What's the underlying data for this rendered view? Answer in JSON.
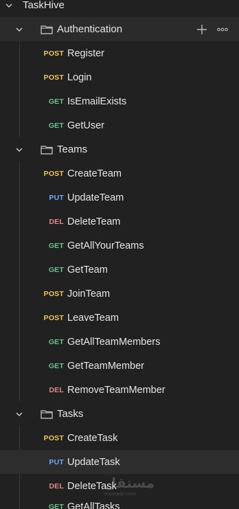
{
  "tree": {
    "root_label": "TaskHive",
    "folders": [
      {
        "label": "Authentication",
        "requests": [
          {
            "method": "POST",
            "name": "Register"
          },
          {
            "method": "POST",
            "name": "Login"
          },
          {
            "method": "GET",
            "name": "IsEmailExists"
          },
          {
            "method": "GET",
            "name": "GetUser"
          }
        ]
      },
      {
        "label": "Teams",
        "requests": [
          {
            "method": "POST",
            "name": "CreateTeam"
          },
          {
            "method": "PUT",
            "name": "UpdateTeam"
          },
          {
            "method": "DEL",
            "name": "DeleteTeam"
          },
          {
            "method": "GET",
            "name": "GetAllYourTeams"
          },
          {
            "method": "GET",
            "name": "GetTeam"
          },
          {
            "method": "POST",
            "name": "JoinTeam"
          },
          {
            "method": "POST",
            "name": "LeaveTeam"
          },
          {
            "method": "GET",
            "name": "GetAllTeamMembers"
          },
          {
            "method": "GET",
            "name": "GetTeamMember"
          },
          {
            "method": "DEL",
            "name": "RemoveTeamMember"
          }
        ]
      },
      {
        "label": "Tasks",
        "requests": [
          {
            "method": "POST",
            "name": "CreateTask"
          },
          {
            "method": "PUT",
            "name": "UpdateTask"
          },
          {
            "method": "DEL",
            "name": "DeleteTask"
          },
          {
            "method": "GET",
            "name": "GetAllTasks"
          }
        ]
      }
    ]
  },
  "watermark": {
    "main": "مستقل",
    "sub": "mostaql.com"
  },
  "colors": {
    "post": "#f0c75e",
    "get": "#6bc38f",
    "put": "#72a7f7",
    "del": "#e08a8a",
    "background": "#212121"
  }
}
